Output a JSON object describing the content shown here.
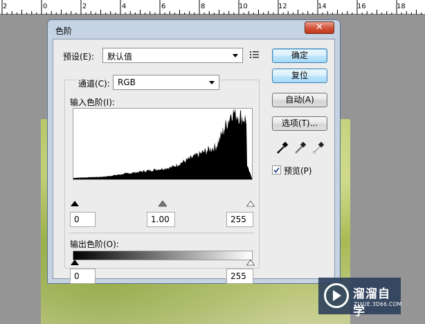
{
  "ruler": {
    "labels": [
      "2",
      "0",
      "2",
      "4",
      "6",
      "8",
      "10",
      "12",
      "14",
      "16",
      "18"
    ]
  },
  "dialog": {
    "title": "色阶",
    "close_label": "✕",
    "preset": {
      "label": "预设(E):",
      "value": "默认值",
      "menu_icon": "list-menu-icon"
    },
    "channel": {
      "label": "通道(C):",
      "value": "RGB"
    },
    "input_levels_label": "输入色阶(I):",
    "input_values": {
      "black": "0",
      "gamma": "1.00",
      "white": "255"
    },
    "output_levels_label": "输出色阶(O):",
    "output_values": {
      "black": "0",
      "white": "255"
    },
    "buttons": {
      "ok": "确定",
      "reset": "复位",
      "auto": "自动(A)",
      "options": "选项(T)..."
    },
    "eyedroppers": [
      "black-eyedropper-icon",
      "gray-eyedropper-icon",
      "white-eyedropper-icon"
    ],
    "preview": {
      "label": "预览(P)",
      "checked": true
    }
  },
  "watermark": {
    "title": "溜溜自学",
    "subtitle": "ZIXUE.3D66.COM"
  },
  "colors": {
    "dialog_frame": "#c6d3e3",
    "client": "#ececec",
    "close": "#c2371d",
    "default_button": "#a7d9f5"
  }
}
